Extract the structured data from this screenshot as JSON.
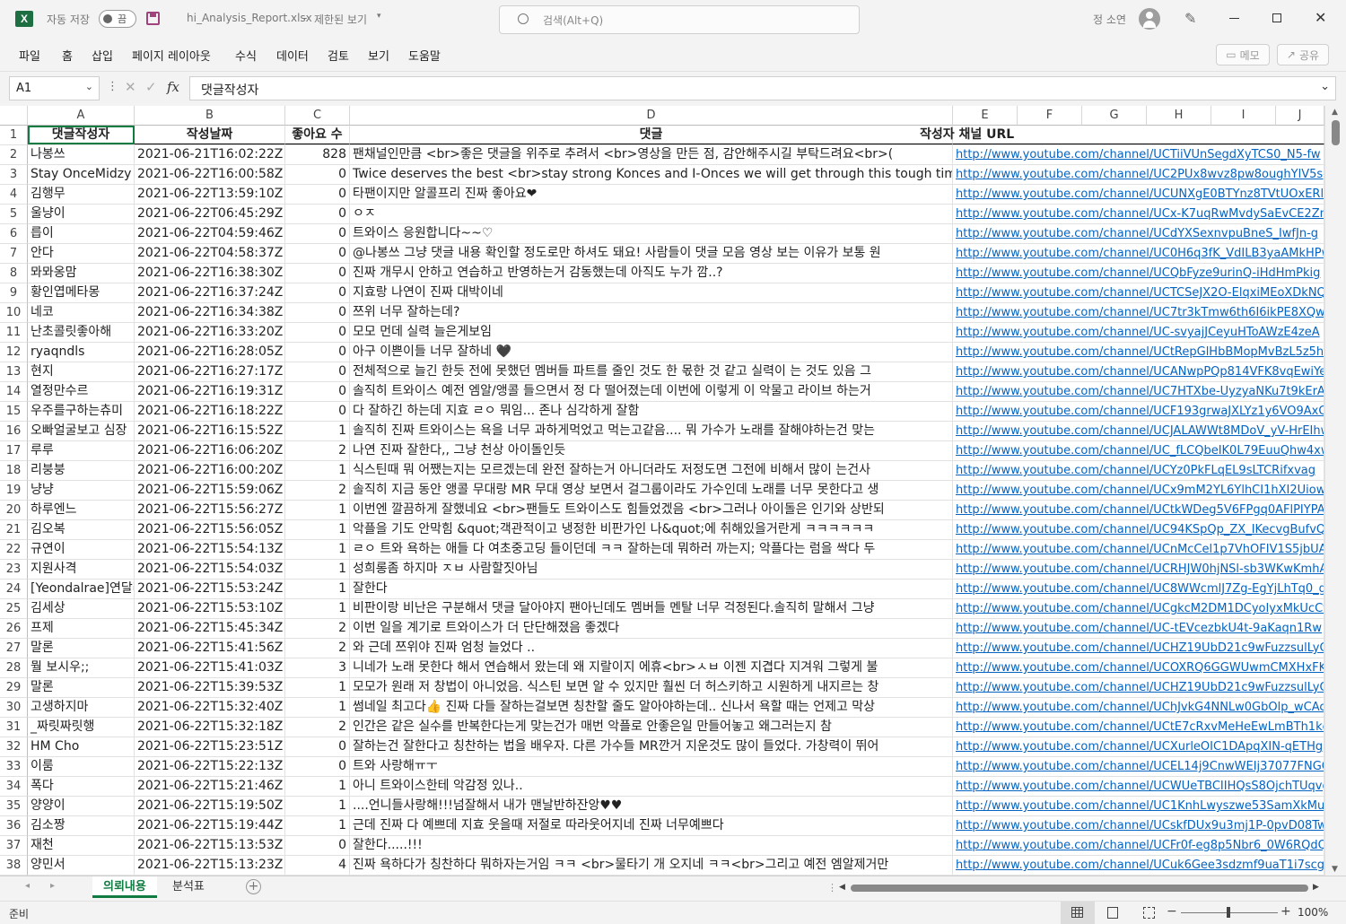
{
  "titlebar": {
    "autosave_label": "자동 저장",
    "autosave_state": "끔",
    "filename": "hi_Analysis_Report.xlsx",
    "separator": "-",
    "view_mode": "제한된 보기",
    "search_placeholder": "검색(Alt+Q)",
    "user_name": "정 소연"
  },
  "menu": [
    "파일",
    "홈",
    "삽입",
    "페이지 레이아웃",
    "수식",
    "데이터",
    "검토",
    "보기",
    "도움말"
  ],
  "toolbar_right": {
    "memo": "메모",
    "share": "공유"
  },
  "formula_bar": {
    "name_box": "A1",
    "fx": "fx",
    "content": "댓글작성자"
  },
  "columns": [
    "A",
    "B",
    "C",
    "D",
    "E",
    "F",
    "G",
    "H",
    "I",
    "J"
  ],
  "header_row": {
    "author": "댓글작성자",
    "date": "작성날짜",
    "likes": "좋아요 수",
    "comment": "댓글",
    "channel": "작성자 채널 URL"
  },
  "rows": [
    {
      "n": "2",
      "author": "나봉쓰",
      "date": "2021-06-21T16:02:22Z",
      "likes": "828",
      "comment": "팬채널인만큼 <br>좋은 댓글을 위주로 추려서 <br>영상을 만든 점, 감안해주시길 부탁드려요<br>(",
      "url": "http://www.youtube.com/channel/UCTiiVUnSegdXyTCS0_N5-fw"
    },
    {
      "n": "3",
      "author": "Stay OnceMidzy",
      "date": "2021-06-22T16:00:58Z",
      "likes": "0",
      "comment": "Twice deserves the best <br>stay strong Konces and I-Onces we will get through this tough time",
      "url": "http://www.youtube.com/channel/UC2PUx8wvz8pw8oughYlV5sg"
    },
    {
      "n": "4",
      "author": "김행무",
      "date": "2021-06-22T13:59:10Z",
      "likes": "0",
      "comment": "타팬이지만 알콜프리 진짜 좋아요❤",
      "url": "http://www.youtube.com/channel/UCUNXgE0BTYnz8TVtUOxERlg"
    },
    {
      "n": "5",
      "author": "울냥이",
      "date": "2021-06-22T06:45:29Z",
      "likes": "0",
      "comment": "ㅇㅈ",
      "url": "http://www.youtube.com/channel/UCx-K7uqRwMvdySaEvCE2ZmQ"
    },
    {
      "n": "6",
      "author": "릅이",
      "date": "2021-06-22T04:59:46Z",
      "likes": "0",
      "comment": "트와이스 응원합니다~~♡",
      "url": "http://www.youtube.com/channel/UCdYXSexnvpuBneS_IwfJn-g"
    },
    {
      "n": "7",
      "author": "안다",
      "date": "2021-06-22T04:58:37Z",
      "likes": "0",
      "comment": "@나봉쓰 그냥 댓글 내용 확인할 정도로만 하셔도 돼요! 사람들이 댓글 모음 영상 보는 이유가 보통 원",
      "url": "http://www.youtube.com/channel/UC0H6q3fK_VdILB3yaAMkHPw"
    },
    {
      "n": "8",
      "author": "뫄뫄옹맘",
      "date": "2021-06-22T16:38:30Z",
      "likes": "0",
      "comment": "진짜 개무시 안하고 연습하고 반영하는거 감동했는데 아직도 누가 깜..?",
      "url": "http://www.youtube.com/channel/UCQbFyze9urinQ-iHdHmPkig"
    },
    {
      "n": "9",
      "author": "황인엽메타몽",
      "date": "2021-06-22T16:37:24Z",
      "likes": "0",
      "comment": "지효랑 나연이 진짜 대박이네",
      "url": "http://www.youtube.com/channel/UCTCSeJX2O-ElqxiMEoXDkNQ"
    },
    {
      "n": "10",
      "author": "네코",
      "date": "2021-06-22T16:34:38Z",
      "likes": "0",
      "comment": "쯔위 너무 잘하는데?",
      "url": "http://www.youtube.com/channel/UC7tr3kTmw6th6I6ikPE8XQw"
    },
    {
      "n": "11",
      "author": "난초콜릿좋아해",
      "date": "2021-06-22T16:33:20Z",
      "likes": "0",
      "comment": "모모 먼데 실력 늘은게보임",
      "url": "http://www.youtube.com/channel/UC-svyajJCeyuHToAWzE4zeA"
    },
    {
      "n": "12",
      "author": "ryaqndls",
      "date": "2021-06-22T16:28:05Z",
      "likes": "0",
      "comment": "아구 이쁜이들 너무 잘하네 🖤",
      "url": "http://www.youtube.com/channel/UCtRepGlHbBMopMvBzL5z5hA"
    },
    {
      "n": "13",
      "author": "현지",
      "date": "2021-06-22T16:27:17Z",
      "likes": "0",
      "comment": "전체적으로 늘긴 한듯 전에 못했던 멤버들 파트를 줄인 것도 한 몫한 것 같고 실력이 는 것도 있음 그",
      "url": "http://www.youtube.com/channel/UCANwpPQp814VFK8vqEwiYeA"
    },
    {
      "n": "14",
      "author": "열정만수르",
      "date": "2021-06-22T16:19:31Z",
      "likes": "0",
      "comment": "솔직히 트와이스 예전 엠알/앵콜 들으면서 정 다 떨어졌는데 이번에 이렇게 이 악물고 라이브 하는거",
      "url": "http://www.youtube.com/channel/UC7HTXbe-UyzyaNKu7t9kErA"
    },
    {
      "n": "15",
      "author": "우주를구하는츄미",
      "date": "2021-06-22T16:18:22Z",
      "likes": "0",
      "comment": "다 잘하긴 하는데 지효 ㄹㅇ 뭐임... 존나 심각하게 잘함",
      "url": "http://www.youtube.com/channel/UCF193grwaJXLYz1y6VO9AxQ"
    },
    {
      "n": "16",
      "author": "오빠얼굴보고 심장",
      "date": "2021-06-22T16:15:52Z",
      "likes": "1",
      "comment": "솔직히 진짜 트와이스는 욕을 너무 과하게먹었고 먹는고같음.... 뭐 가수가 노래를 잘해야하는건 맞는",
      "url": "http://www.youtube.com/channel/UCJALAWWt8MDoV_yV-HrEIhw"
    },
    {
      "n": "17",
      "author": "루루",
      "date": "2021-06-22T16:06:20Z",
      "likes": "2",
      "comment": "나연 진짜 잘한다,, 그냥 천상 아이돌인듯",
      "url": "http://www.youtube.com/channel/UC_fLCQbeIK0L79EuuQhw4xw"
    },
    {
      "n": "18",
      "author": "리붕붕",
      "date": "2021-06-22T16:00:20Z",
      "likes": "1",
      "comment": "식스틴때 뭐 어쨌는지는 모르겠는데 완전 잘하는거 아니더라도 저정도면 그전에 비해서 많이 는건사",
      "url": "http://www.youtube.com/channel/UCYz0PkFLqEL9sLTCRifxvag"
    },
    {
      "n": "19",
      "author": "냥냥",
      "date": "2021-06-22T15:59:06Z",
      "likes": "2",
      "comment": "솔직히 지금 동안 앵콜 무대랑 MR 무대 영상 보면서 걸그룹이라도 가수인데 노래를 너무 못한다고 생",
      "url": "http://www.youtube.com/channel/UCx9mM2YL6YlhCI1hXI2Uiow"
    },
    {
      "n": "20",
      "author": "하루엔느",
      "date": "2021-06-22T15:56:27Z",
      "likes": "1",
      "comment": "이번엔 깔끔하게 잘했네요 <br>팬들도 트와이스도 힘들었겠음 <br>그러나 아이돌은 인기와 상반되",
      "url": "http://www.youtube.com/channel/UCtkWDeg5V6FPgq0AFlPIYPA"
    },
    {
      "n": "21",
      "author": "김오복",
      "date": "2021-06-22T15:56:05Z",
      "likes": "1",
      "comment": "악플을 기도 안막힘 &quot;객관적이고 냉정한 비판가인 나&quot;에 취해있을거란게 ㅋㅋㅋㅋㅋㅋ",
      "url": "http://www.youtube.com/channel/UC94KSpQp_ZX_IKecvgBufvQ"
    },
    {
      "n": "22",
      "author": "규연이",
      "date": "2021-06-22T15:54:13Z",
      "likes": "1",
      "comment": "ㄹㅇ 트와 욕하는 애들 다 여초중고딩 들이던데 ㅋㅋ 잘하는데 뭐하러 까는지; 악플다는 럼을 싹다 두",
      "url": "http://www.youtube.com/channel/UCnMcCel1p7VhOFIV1S5jbUA"
    },
    {
      "n": "23",
      "author": "지원사격",
      "date": "2021-06-22T15:54:03Z",
      "likes": "1",
      "comment": "성희롱좀 하지마 ㅈㅂ 사람할짓아님",
      "url": "http://www.youtube.com/channel/UCRHJW0hjNSl-sb3WKwKmhAg"
    },
    {
      "n": "24",
      "author": "[Yeondalrae]연달래",
      "date": "2021-06-22T15:53:24Z",
      "likes": "1",
      "comment": "잘한다",
      "url": "http://www.youtube.com/channel/UC8WWcmlJ7Zg-EgYjLhTq0_g"
    },
    {
      "n": "25",
      "author": "김세상",
      "date": "2021-06-22T15:53:10Z",
      "likes": "1",
      "comment": "비판이랑 비난은 구분해서 댓글 달아야지 팬아닌데도 멤버들 멘탈 너무 걱정된다.솔직히 말해서 그냥",
      "url": "http://www.youtube.com/channel/UCgkcM2DM1DCyoIyxMkUcCfw"
    },
    {
      "n": "26",
      "author": "프제",
      "date": "2021-06-22T15:45:34Z",
      "likes": "2",
      "comment": "이번 일을 계기로 트와이스가 더 단단해졌음 좋겠다",
      "url": "http://www.youtube.com/channel/UC-tEVcezbkU4t-9aKaqn1Rw"
    },
    {
      "n": "27",
      "author": "말론",
      "date": "2021-06-22T15:41:56Z",
      "likes": "2",
      "comment": "와 근데 쯔위야 진짜 엄청 늘었다 ..",
      "url": "http://www.youtube.com/channel/UCHZ19UbD21c9wFuzzsulLyQ"
    },
    {
      "n": "28",
      "author": "뭘 보시우;;",
      "date": "2021-06-22T15:41:03Z",
      "likes": "3",
      "comment": "니네가 노래 못한다 해서 연습해서 왔는데 왜 지랄이지 에휴<br>ㅅㅂ 이젠 지겹다 지겨워 그렇게 불",
      "url": "http://www.youtube.com/channel/UCOXRQ6GGWUwmCMXHxFKAw"
    },
    {
      "n": "29",
      "author": "말론",
      "date": "2021-06-22T15:39:53Z",
      "likes": "1",
      "comment": "모모가 원래 저 창법이 아니었음. 식스틴 보면 알 수 있지만 훨씬 더 허스키하고 시원하게 내지르는 창",
      "url": "http://www.youtube.com/channel/UCHZ19UbD21c9wFuzzsulLyQ"
    },
    {
      "n": "30",
      "author": "고생하지마",
      "date": "2021-06-22T15:32:40Z",
      "likes": "1",
      "comment": "썸네일 최고다👍 진짜 다들 잘하는걸보면 칭찬할 줄도 알아야하는데.. 신나서 욕할 때는 언제고 막상",
      "url": "http://www.youtube.com/channel/UChJvkG4NNLw0GbOlp_wCAcw"
    },
    {
      "n": "31",
      "author": "_짜릿짜릿행",
      "date": "2021-06-22T15:32:18Z",
      "likes": "2",
      "comment": "인간은 같은 실수를 반복한다는게 맞는건가 매번 악플로 안좋은일 만들어놓고 왜그러는지 참",
      "url": "http://www.youtube.com/channel/UCtE7cRxvMeHeEwLmBTh1kcQ"
    },
    {
      "n": "32",
      "author": "HM Cho",
      "date": "2021-06-22T15:23:51Z",
      "likes": "0",
      "comment": "잘하는건 잘한다고 칭찬하는 법을 배우자. 다른 가수들 MR깐거 지운것도 많이 들었다. 가창력이 뛰어",
      "url": "http://www.youtube.com/channel/UCXurleOIC1DApqXIN-qETHg"
    },
    {
      "n": "33",
      "author": "이룸",
      "date": "2021-06-22T15:22:13Z",
      "likes": "0",
      "comment": "트와 사랑해ㅠㅜ",
      "url": "http://www.youtube.com/channel/UCEL14j9CnwWEIj37077FNGQ"
    },
    {
      "n": "34",
      "author": "폭다",
      "date": "2021-06-22T15:21:46Z",
      "likes": "1",
      "comment": "아니 트와이스한테 악감정 있나..",
      "url": "http://www.youtube.com/channel/UCWUeTBCIIHQsS8OjchTUqvg"
    },
    {
      "n": "35",
      "author": "양양이",
      "date": "2021-06-22T15:19:50Z",
      "likes": "1",
      "comment": "....언니들사랑해!!!넘잘해서 내가 맨날반하잔앙♥♥",
      "url": "http://www.youtube.com/channel/UC1KnhLwyszwe53SamXkMueg"
    },
    {
      "n": "36",
      "author": "김소짱",
      "date": "2021-06-22T15:19:44Z",
      "likes": "1",
      "comment": "근데 진짜 다 예쁘데 지효 웃을때 저절로 따라웃어지네 진짜 너무예쁘다",
      "url": "http://www.youtube.com/channel/UCskfDUx9u3mj1P-0pvD08Tw"
    },
    {
      "n": "37",
      "author": "재천",
      "date": "2021-06-22T15:13:53Z",
      "likes": "0",
      "comment": "잘한다.....!!!",
      "url": "http://www.youtube.com/channel/UCFr0f-eg8p5Nbr6_0W6RQdQ"
    },
    {
      "n": "38",
      "author": "양민서",
      "date": "2021-06-22T15:13:23Z",
      "likes": "4",
      "comment": "진짜 욕하다가 칭찬하다 뭐하자는거임 ㅋㅋ <br>물타기 개 오지네 ㅋㅋ<br>그리고 예전 엠알제거만",
      "url": "http://www.youtube.com/channel/UCuk6Gee3sdzmf9uaT1i7scg"
    }
  ],
  "sheets": [
    {
      "label": "의뢰내용",
      "active": true
    },
    {
      "label": "분석표",
      "active": false
    }
  ],
  "status": {
    "ready": "준비",
    "zoom": "100%"
  },
  "colors": {
    "excel_green": "#1d6f42",
    "link": "#0563c1",
    "sheet_tab_green": "#107c41"
  }
}
